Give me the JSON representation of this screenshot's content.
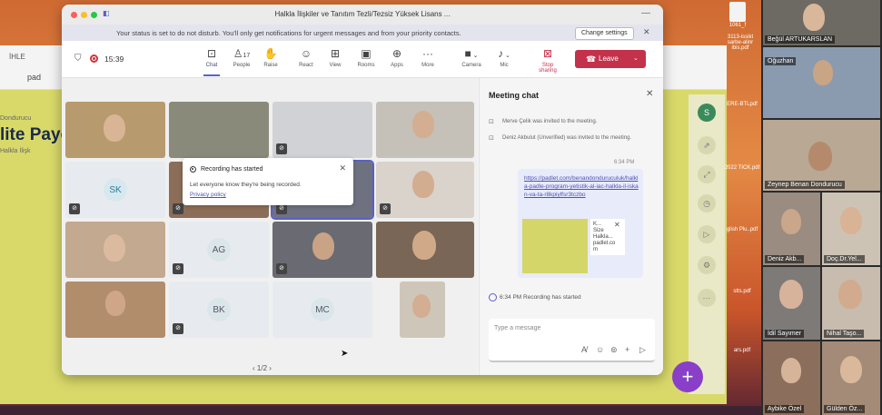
{
  "window": {
    "title": "Halkla İlişkiler ve Tanıtım Tezli/Tezsiz Yüksek Lisans ..."
  },
  "banner": {
    "message": "Your status is set to do not disturb. You'll only get notifications for urgent messages and from your priority contacts.",
    "button": "Change settings"
  },
  "toolbar": {
    "timer": "15:39",
    "buttons": [
      {
        "label": "Chat",
        "icon": "chat-icon",
        "glyph": "⊡"
      },
      {
        "label": "People",
        "icon": "people-icon",
        "glyph": "♙",
        "badge": "17"
      },
      {
        "label": "Raise",
        "icon": "raise-hand-icon",
        "glyph": "✋"
      },
      {
        "label": "React",
        "icon": "react-icon",
        "glyph": "☺"
      },
      {
        "label": "View",
        "icon": "view-icon",
        "glyph": "⊞"
      },
      {
        "label": "Rooms",
        "icon": "rooms-icon",
        "glyph": "▣"
      },
      {
        "label": "Apps",
        "icon": "apps-icon",
        "glyph": "⊕"
      },
      {
        "label": "More",
        "icon": "more-icon",
        "glyph": "···"
      },
      {
        "label": "Camera",
        "icon": "camera-icon",
        "glyph": "■"
      },
      {
        "label": "Mic",
        "icon": "mic-icon",
        "glyph": "♪"
      },
      {
        "label": "Stop sharing",
        "icon": "stop-sharing-icon",
        "glyph": "⊠"
      }
    ],
    "leave": "Leave"
  },
  "toast": {
    "title": "Recording has started",
    "body": "Let everyone know they're being recorded.",
    "link": "Privacy policy"
  },
  "tiles": {
    "sk": "SK",
    "ag": "AG",
    "bk": "BK",
    "mc": "MC"
  },
  "pager": "1/2",
  "chat": {
    "title": "Meeting chat",
    "events": [
      "Merve Çelik was invited to the meeting.",
      "Deniz Akbulut (Unverified) was invited to the meeting."
    ],
    "time": "6:34 PM",
    "url": "https://padlet.com/benandonduruculuk/halkla-padle-program-yetistik-al-iac-halkla-il-iskan-va-ta-r8kpiylfsr3tczbo",
    "card": [
      "K...",
      "Size",
      "Halkla...",
      "padlet.co",
      "m"
    ],
    "recording_event": "6:34 PM Recording has started",
    "placeholder": "Type a message"
  },
  "browser": {
    "tab": "İHLE",
    "address": "pad",
    "title": "lite Payo",
    "sub": "Dondurucu",
    "sub2": "Halkla İlişk"
  },
  "participants": [
    "Beğül ARTUKARSLAN",
    "Oğuzhan",
    "Zeynep Benan Dondurucu",
    "Deniz Akb...",
    "Doç.Dr.Yel...",
    "İdil Sayımer",
    "Nihal Taşo...",
    "Aybike Özel",
    "Gülden Öz..."
  ],
  "desktop_files": [
    "1061_f",
    "3113-issikt sarbe-alinr ibis.pdf",
    "ERE-BTLpdf",
    "2022 TICK.pdf",
    "glish Plu..pdf",
    "stts.pdf",
    "ars.pdf"
  ],
  "colors": {
    "accent": "#5b5fc7",
    "leave": "#c4314b"
  }
}
